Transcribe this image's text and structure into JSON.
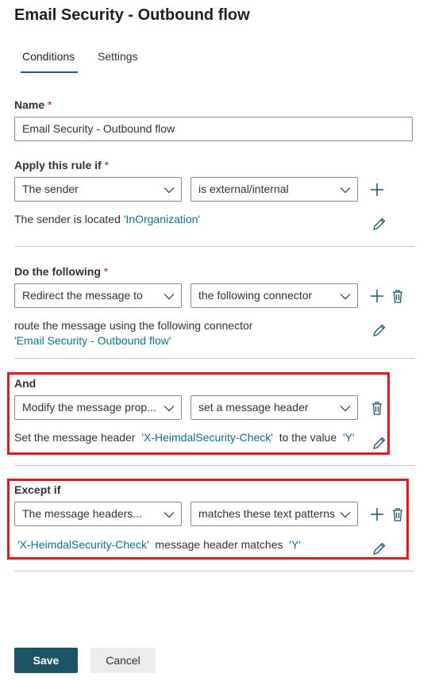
{
  "page": {
    "title": "Email Security - Outbound flow"
  },
  "tabs": [
    {
      "label": "Conditions",
      "selected": true
    },
    {
      "label": "Settings",
      "selected": false
    }
  ],
  "name_field": {
    "label": "Name",
    "required_mark": "*",
    "value": "Email Security - Outbound flow"
  },
  "apply_rule": {
    "label": "Apply this rule if",
    "required_mark": "*",
    "condition": "The sender",
    "operator": "is external/internal",
    "desc_prefix": "The sender is located",
    "desc_value": "'InOrganization'"
  },
  "do_following": {
    "label": "Do the following",
    "required_mark": "*",
    "action": "Redirect the message to",
    "target": "the following connector",
    "desc_line1": "route the message using the following connector",
    "desc_value": "'Email Security - Outbound flow'"
  },
  "and_block": {
    "label": "And",
    "action": "Modify the message prop...",
    "target": "set a message header",
    "desc_prefix": "Set the message header",
    "desc_header": "'X-HeimdalSecurity-Check'",
    "desc_mid": "to the value",
    "desc_value": "'Y'"
  },
  "except_block": {
    "label": "Except if",
    "condition": "The message headers...",
    "operator": "matches these text patterns",
    "desc_header": "'X-HeimdalSecurity-Check'",
    "desc_mid": "message header matches",
    "desc_value": "'Y'"
  },
  "buttons": {
    "save": "Save",
    "cancel": "Cancel"
  },
  "colors": {
    "accent": "#1c5466",
    "link": "#0f6e8c",
    "highlight": "#e0191f",
    "required": "#a4262c"
  }
}
